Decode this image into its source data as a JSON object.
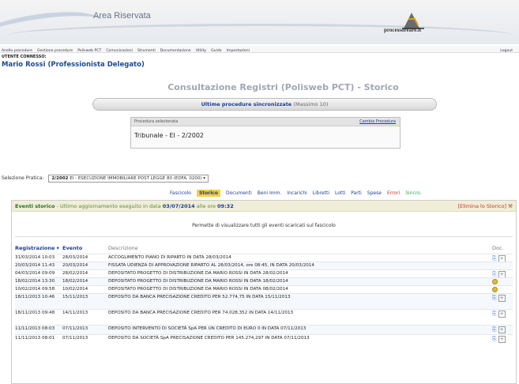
{
  "header": {
    "title": "Area Riservata",
    "logo_text": "processoreare.it"
  },
  "menu": {
    "items": [
      "Anello procedure",
      "Gestione procedure",
      "Polisweb PCT",
      "Comunicazioni",
      "Strumenti",
      "Documentazione",
      "Utility",
      "Guide",
      "Impostazioni"
    ],
    "right": "Logout"
  },
  "user": {
    "label": "UTENTE CONNESSO:",
    "name": "Mario Rossi (Professionista Delegato)"
  },
  "page": {
    "title": "Consultazione Registri (Polisweb PCT) - Storico"
  },
  "sync_bar": {
    "label": "Ultime procedure sincronizzate",
    "suffix": "(Massimo 10)"
  },
  "selected_procedure": {
    "header": "Procedura selezionata",
    "change_link": "Cambia Procedura",
    "value": "Tribunale - EI - 2/2002"
  },
  "pratica": {
    "label": "Selezione Pratica:",
    "code": "2/2002",
    "value": "EI - ESECUZIONE IMMOBILIARE POST LEGGE 80 (EDFA. 0200)"
  },
  "tabs": [
    "Fascicolo",
    "Storico",
    "Documenti",
    "Beni Imm.",
    "Incarichi",
    "Libretti",
    "Lotti",
    "Parti",
    "Spese",
    "Errori",
    "Sincro."
  ],
  "events": {
    "title": "Eventi storico",
    "msg": "- Ultimo aggiornamento eseguito in data",
    "date": "03/07/2014",
    "at": "alle ore",
    "time": "09:32",
    "delete": "[Elimina lo Storico]",
    "note": "Permette di visualizzare tutti gli eventi scaricati sul fascicolo",
    "columns": [
      "Registrazione ▾",
      "Evento",
      "Descrizione",
      "Doc."
    ],
    "rows": [
      {
        "reg": "31/03/2014 10:03",
        "ev": "28/03/2014",
        "desc": "ACCOGLIMENTO PIANO DI RIPARTO IN DATA 28/03/2014",
        "doc": "both"
      },
      {
        "reg": "20/03/2014 11:43",
        "ev": "20/03/2014",
        "desc": "FISSATA UDIENZA DI APPROVAZIONE RIPARTO AL 28/03/2014, ore 08:45, IN DATA 20/03/2014",
        "doc": "none"
      },
      {
        "reg": "04/03/2014 09:09",
        "ev": "28/02/2014",
        "desc": "DEPOSITATO PROGETTO DI DISTRIBUZIONE DA MARIO ROSSI IN DATA 28/02/2014",
        "doc": "both"
      },
      {
        "reg": "18/02/2014 13:30",
        "ev": "18/02/2014",
        "desc": "DEPOSITATO PROGETTO DI DISTRIBUZIONE DA MARIO ROSSI IN DATA 18/02/2014",
        "doc": "coin"
      },
      {
        "reg": "10/02/2014 09:58",
        "ev": "10/02/2014",
        "desc": "DEPOSITATO PROGETTO DI DISTRIBUZIONE DA MARIO ROSSI IN DATA 08/02/2014",
        "doc": "coin"
      },
      {
        "reg": "18/11/2013 10:46",
        "ev": "15/11/2013",
        "desc": "DEPOSITO DA BANCA PRECISAZIONE CREDITO PER 52.774,75 IN DATA 15/11/2013",
        "doc": "both"
      },
      {
        "reg": "18/11/2013 09:48",
        "ev": "14/11/2013",
        "desc": "DEPOSITO DA BANCA PRECISAZIONE CREDITO PER 74.028,352 IN DATA 14/11/2013",
        "doc": "both"
      },
      {
        "reg": "11/11/2013 08:03",
        "ev": "07/11/2013",
        "desc": "DEPOSITO INTERVENTO DI SOCIETÀ SpA PER UN CREDITO DI EURO 0 IN DATA 07/11/2013",
        "doc": "both"
      },
      {
        "reg": "11/11/2013 08:01",
        "ev": "07/11/2013",
        "desc": "DEPOSITO DA SOCIETÀ SpA PRECISAZIONE CREDITO PER 145.274,297 IN DATA 07/11/2013",
        "doc": "both"
      }
    ]
  }
}
